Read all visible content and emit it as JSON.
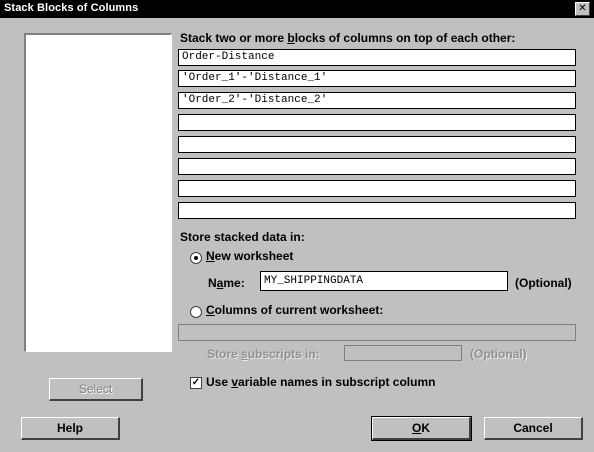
{
  "window": {
    "title": "Stack Blocks of Columns",
    "close_symbol": "✕"
  },
  "instructions": {
    "pre": "Stack two or more ",
    "accel": "b",
    "post": "locks of columns on top of each other:"
  },
  "blocks": [
    "Order-Distance",
    "'Order_1'-'Distance_1'",
    "'Order_2'-'Distance_2'",
    "",
    "",
    "",
    "",
    ""
  ],
  "store": {
    "heading": "Store stacked data in:",
    "new_worksheet_accel": "N",
    "new_worksheet_rest": "ew worksheet",
    "name_pre": "N",
    "name_accel": "a",
    "name_post": "me:",
    "name_value": "MY_SHIPPINGDATA",
    "optional": "(Optional)",
    "current_accel": "C",
    "current_rest": "olumns of current worksheet:",
    "current_value": "",
    "subscripts_pre": "Store ",
    "subscripts_accel": "s",
    "subscripts_post": "ubscripts in:",
    "subscripts_value": "",
    "subscripts_optional": "(Optional)"
  },
  "use_varnames": {
    "pre": "Use ",
    "accel": "v",
    "post": "ariable names in subscript column",
    "checked": true,
    "mark": "✓"
  },
  "buttons": {
    "select": "Select",
    "help": "Help",
    "ok_accel": "O",
    "ok_rest": "K",
    "cancel": "Cancel"
  }
}
